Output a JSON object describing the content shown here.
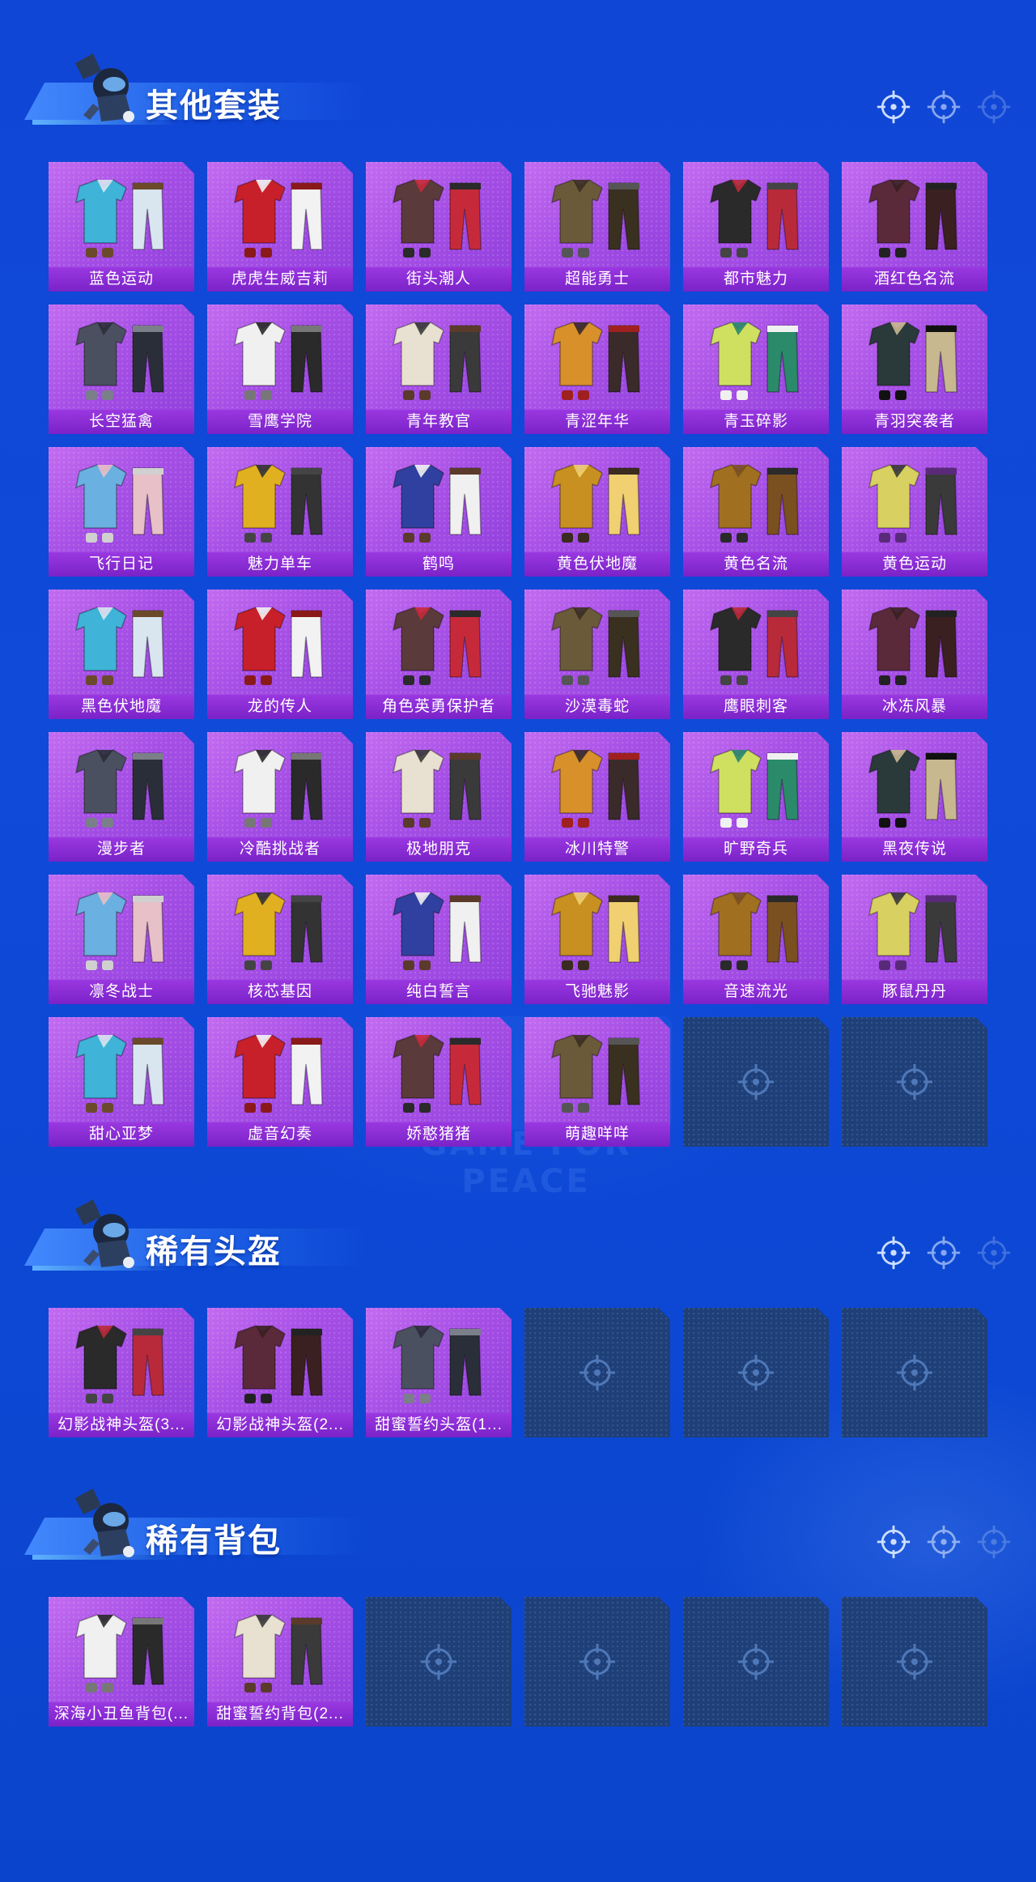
{
  "sections": [
    {
      "title": "其他套装",
      "items": [
        "蓝色运动",
        "虎虎生威吉莉",
        "街头潮人",
        "超能勇士",
        "都市魅力",
        "酒红色名流",
        "长空猛禽",
        "雪鹰学院",
        "青年教官",
        "青涩年华",
        "青玉碎影",
        "青羽突袭者",
        "飞行日记",
        "魅力单车",
        "鹤鸣",
        "黄色伏地魔",
        "黄色名流",
        "黄色运动",
        "黑色伏地魔",
        "龙的传人",
        "角色英勇保护者",
        "沙漠毒蛇",
        "鹰眼刺客",
        "冰冻风暴",
        "漫步者",
        "冷酷挑战者",
        "极地朋克",
        "冰川特警",
        "旷野奇兵",
        "黑夜传说",
        "凛冬战士",
        "核芯基因",
        "纯白誓言",
        "飞驰魅影",
        "音速流光",
        "豚鼠丹丹",
        "甜心亚梦",
        "虚音幻奏",
        "娇憨猪猪",
        "萌趣咩咩"
      ],
      "empty_slots": 2
    },
    {
      "title": "稀有头盔",
      "items": [
        "幻影战神头盔(3...",
        "幻影战神头盔(2...",
        "甜蜜誓约头盔(1..."
      ],
      "empty_slots": 3
    },
    {
      "title": "稀有背包",
      "items": [
        "深海小丑鱼背包(...",
        "甜蜜誓约背包(2..."
      ],
      "empty_slots": 4
    }
  ],
  "watermark": "GAME FOR PEACE",
  "icons": {
    "header": [
      "crosshair-icon",
      "crosshair-icon",
      "crosshair-icon"
    ],
    "empty_slot": "crosshair-icon",
    "mascot": "soldier-mascot-icon"
  },
  "colors": {
    "background": "#1046d6",
    "card_purple": "#a64fe6",
    "label_purple": "#8a2fd6",
    "empty_slot": "#1f3f78"
  }
}
